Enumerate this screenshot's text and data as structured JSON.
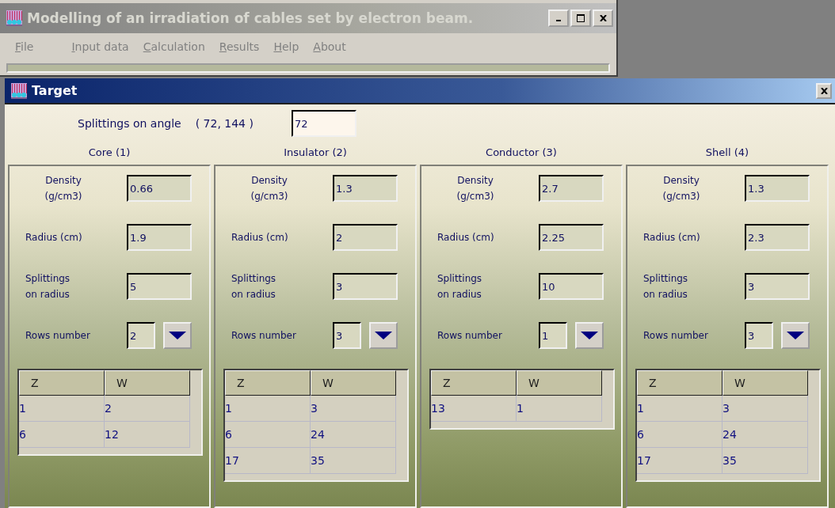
{
  "main_window": {
    "title": "Modelling of an irradiation of cables set by electron beam.",
    "menu": [
      {
        "label": "File"
      },
      {
        "label": "Input data"
      },
      {
        "label": "Calculation"
      },
      {
        "label": "Results"
      },
      {
        "label": "Help"
      },
      {
        "label": "About"
      }
    ]
  },
  "target_window": {
    "title": "Target",
    "angle": {
      "label": "Splittings on angle",
      "range": "( 72, 144 )",
      "value": "72"
    },
    "layers": [
      {
        "heading": "Core (1)",
        "density": {
          "label": "Density\n(g/cm3)",
          "value": "0.66"
        },
        "radius": {
          "label": "Radius (cm)",
          "value": "1.9"
        },
        "splittings": {
          "label": "Splittings\non radius",
          "value": "5"
        },
        "rows_number": {
          "label": "Rows number",
          "value": "2"
        },
        "table": {
          "columns": [
            "Z",
            "W"
          ],
          "rows": [
            [
              "1",
              "2"
            ],
            [
              "6",
              "12"
            ]
          ]
        }
      },
      {
        "heading": "Insulator (2)",
        "density": {
          "label": "Density\n(g/cm3)",
          "value": "1.3"
        },
        "radius": {
          "label": "Radius  (cm)",
          "value": "2"
        },
        "splittings": {
          "label": "Splittings\non radius",
          "value": "3"
        },
        "rows_number": {
          "label": "Rows number",
          "value": "3"
        },
        "table": {
          "columns": [
            "Z",
            "W"
          ],
          "rows": [
            [
              "1",
              "3"
            ],
            [
              "6",
              "24"
            ],
            [
              "17",
              "35"
            ]
          ]
        }
      },
      {
        "heading": "Conductor (3)",
        "density": {
          "label": "Density\n(g/cm3)",
          "value": "2.7"
        },
        "radius": {
          "label": "Radius  (cm)",
          "value": "2.25"
        },
        "splittings": {
          "label": "Splittings\non radius",
          "value": "10"
        },
        "rows_number": {
          "label": "Rows number",
          "value": "1"
        },
        "table": {
          "columns": [
            "Z",
            "W"
          ],
          "rows": [
            [
              "13",
              "1"
            ]
          ]
        }
      },
      {
        "heading": "Shell (4)",
        "density": {
          "label": "Density\n(g/cm3)",
          "value": "1.3"
        },
        "radius": {
          "label": "Radius  (cm)",
          "value": "2.3"
        },
        "splittings": {
          "label": "Splittings\non radius",
          "value": "3"
        },
        "rows_number": {
          "label": "Rows number",
          "value": "3"
        },
        "table": {
          "columns": [
            "Z",
            "W"
          ],
          "rows": [
            [
              "1",
              "3"
            ],
            [
              "6",
              "24"
            ],
            [
              "17",
              "35"
            ]
          ]
        }
      }
    ]
  }
}
